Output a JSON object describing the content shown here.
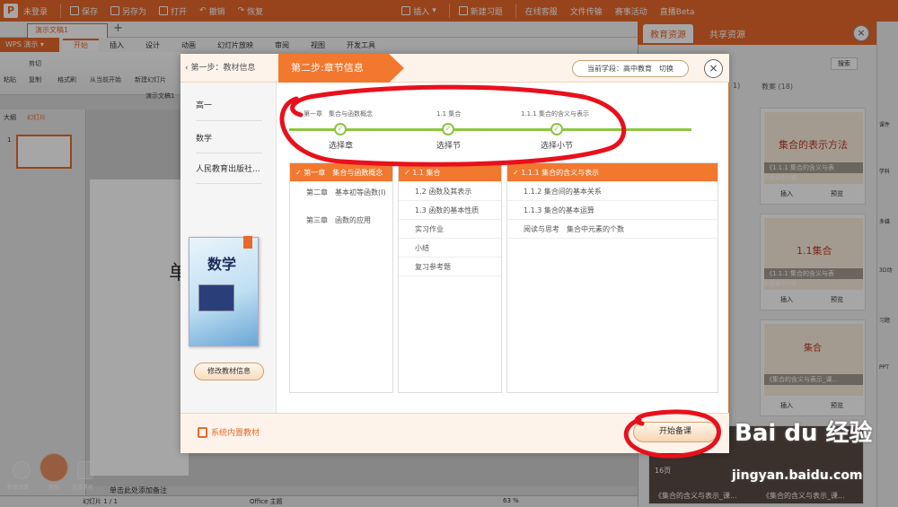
{
  "titlebar": {
    "login": "未登录",
    "save": "保存",
    "save_as": "另存为",
    "open": "打开",
    "undo": "撤销",
    "redo": "恢复",
    "insert": "插入",
    "new_exercise": "新建习题",
    "online_service": "在线客服",
    "file_transfer": "文件传输",
    "events": "赛事活动",
    "live": "直播Beta"
  },
  "doc_tab": "演示文稿1",
  "app_menu": "WPS 演示",
  "ribbon_tabs": [
    "开始",
    "插入",
    "设计",
    "动画",
    "幻灯片放映",
    "审阅",
    "视图",
    "开发工具"
  ],
  "ribbon_buttons": {
    "paste": "粘贴",
    "cut": "剪切",
    "copy": "复制",
    "format_painter": "格式刷",
    "from_current": "从当前开始",
    "new_slide": "新建幻灯片",
    "doc_name": "演示文稿1"
  },
  "left_pane": {
    "tab_outline": "大纲",
    "tab_slides": "幻灯片",
    "slide_num": "1",
    "add_page": "新增页面",
    "play": "放映",
    "connect_phone": "连接手机"
  },
  "editor": {
    "slide_char": "单",
    "notes_hint": "单击此处添加备注",
    "status_slide": "幻灯片 1 / 1",
    "status_theme": "Office 主题",
    "zoom": "63 %"
  },
  "right_panel": {
    "tab_edu": "教育资源",
    "tab_shared": "共享资源",
    "search": "搜索",
    "count_label": "教案 (18)",
    "count_prefix": "1)",
    "cards": [
      {
        "title": "《1.1.1 集合的含义与表",
        "src": "新疆课件大赛",
        "insert": "插入",
        "preview": "预览",
        "heading": "集合的表示方法"
      },
      {
        "title": "《1.1.1 集合的含义与表",
        "src": "新疆课件大赛",
        "insert": "插入",
        "preview": "预览",
        "heading": "1.1集合"
      },
      {
        "title": "《集合的含义与表示_课...",
        "src": "",
        "insert": "插入",
        "preview": "预览",
        "heading": "集合"
      },
      {
        "title": "《集合的含义与表示_课...",
        "src": "",
        "insert": "",
        "preview": "",
        "heading": "",
        "badge": "16页"
      }
    ],
    "far_right": [
      "课件",
      "学科",
      "多媒",
      "3D动",
      "习题",
      "PPT"
    ]
  },
  "dialog": {
    "step1": "第一步：教材信息",
    "step2": "第二步:章节信息",
    "stage_label": "当前学段：高中教育",
    "switch": "切换",
    "close": "×",
    "info": [
      "高一",
      "数学",
      "人民教育出版社..."
    ],
    "book_title": "数学",
    "modify_btn": "修改教材信息",
    "steps": [
      {
        "top": "第一章　集合与函数概念",
        "bottom": "选择章"
      },
      {
        "top": "1.1 集合",
        "bottom": "选择节"
      },
      {
        "top": "1.1.1 集合的含义与表示",
        "bottom": "选择小节"
      }
    ],
    "chapters": [
      "第一章　集合与函数概念",
      "第二章　基本初等函数(Ⅰ)",
      "第三章　函数的应用"
    ],
    "sections": [
      "1.1 集合",
      "1.2 函数及其表示",
      "1.3 函数的基本性质",
      "实习作业",
      "小结",
      "复习参考题"
    ],
    "subsections": [
      "1.1.1 集合的含义与表示",
      "1.1.2 集合间的基本关系",
      "1.1.3 集合的基本运算",
      "阅读与思考　集合中元素的个数"
    ],
    "footer_label": "系统内置教材",
    "start_btn": "开始备课"
  },
  "watermark": {
    "brand": "Bai du 经验",
    "url": "jingyan.baidu.com"
  },
  "colors": {
    "brand": "#e9692c",
    "selected": "#f1782e",
    "progress": "#8cc63f",
    "annotation": "#e8101c"
  }
}
